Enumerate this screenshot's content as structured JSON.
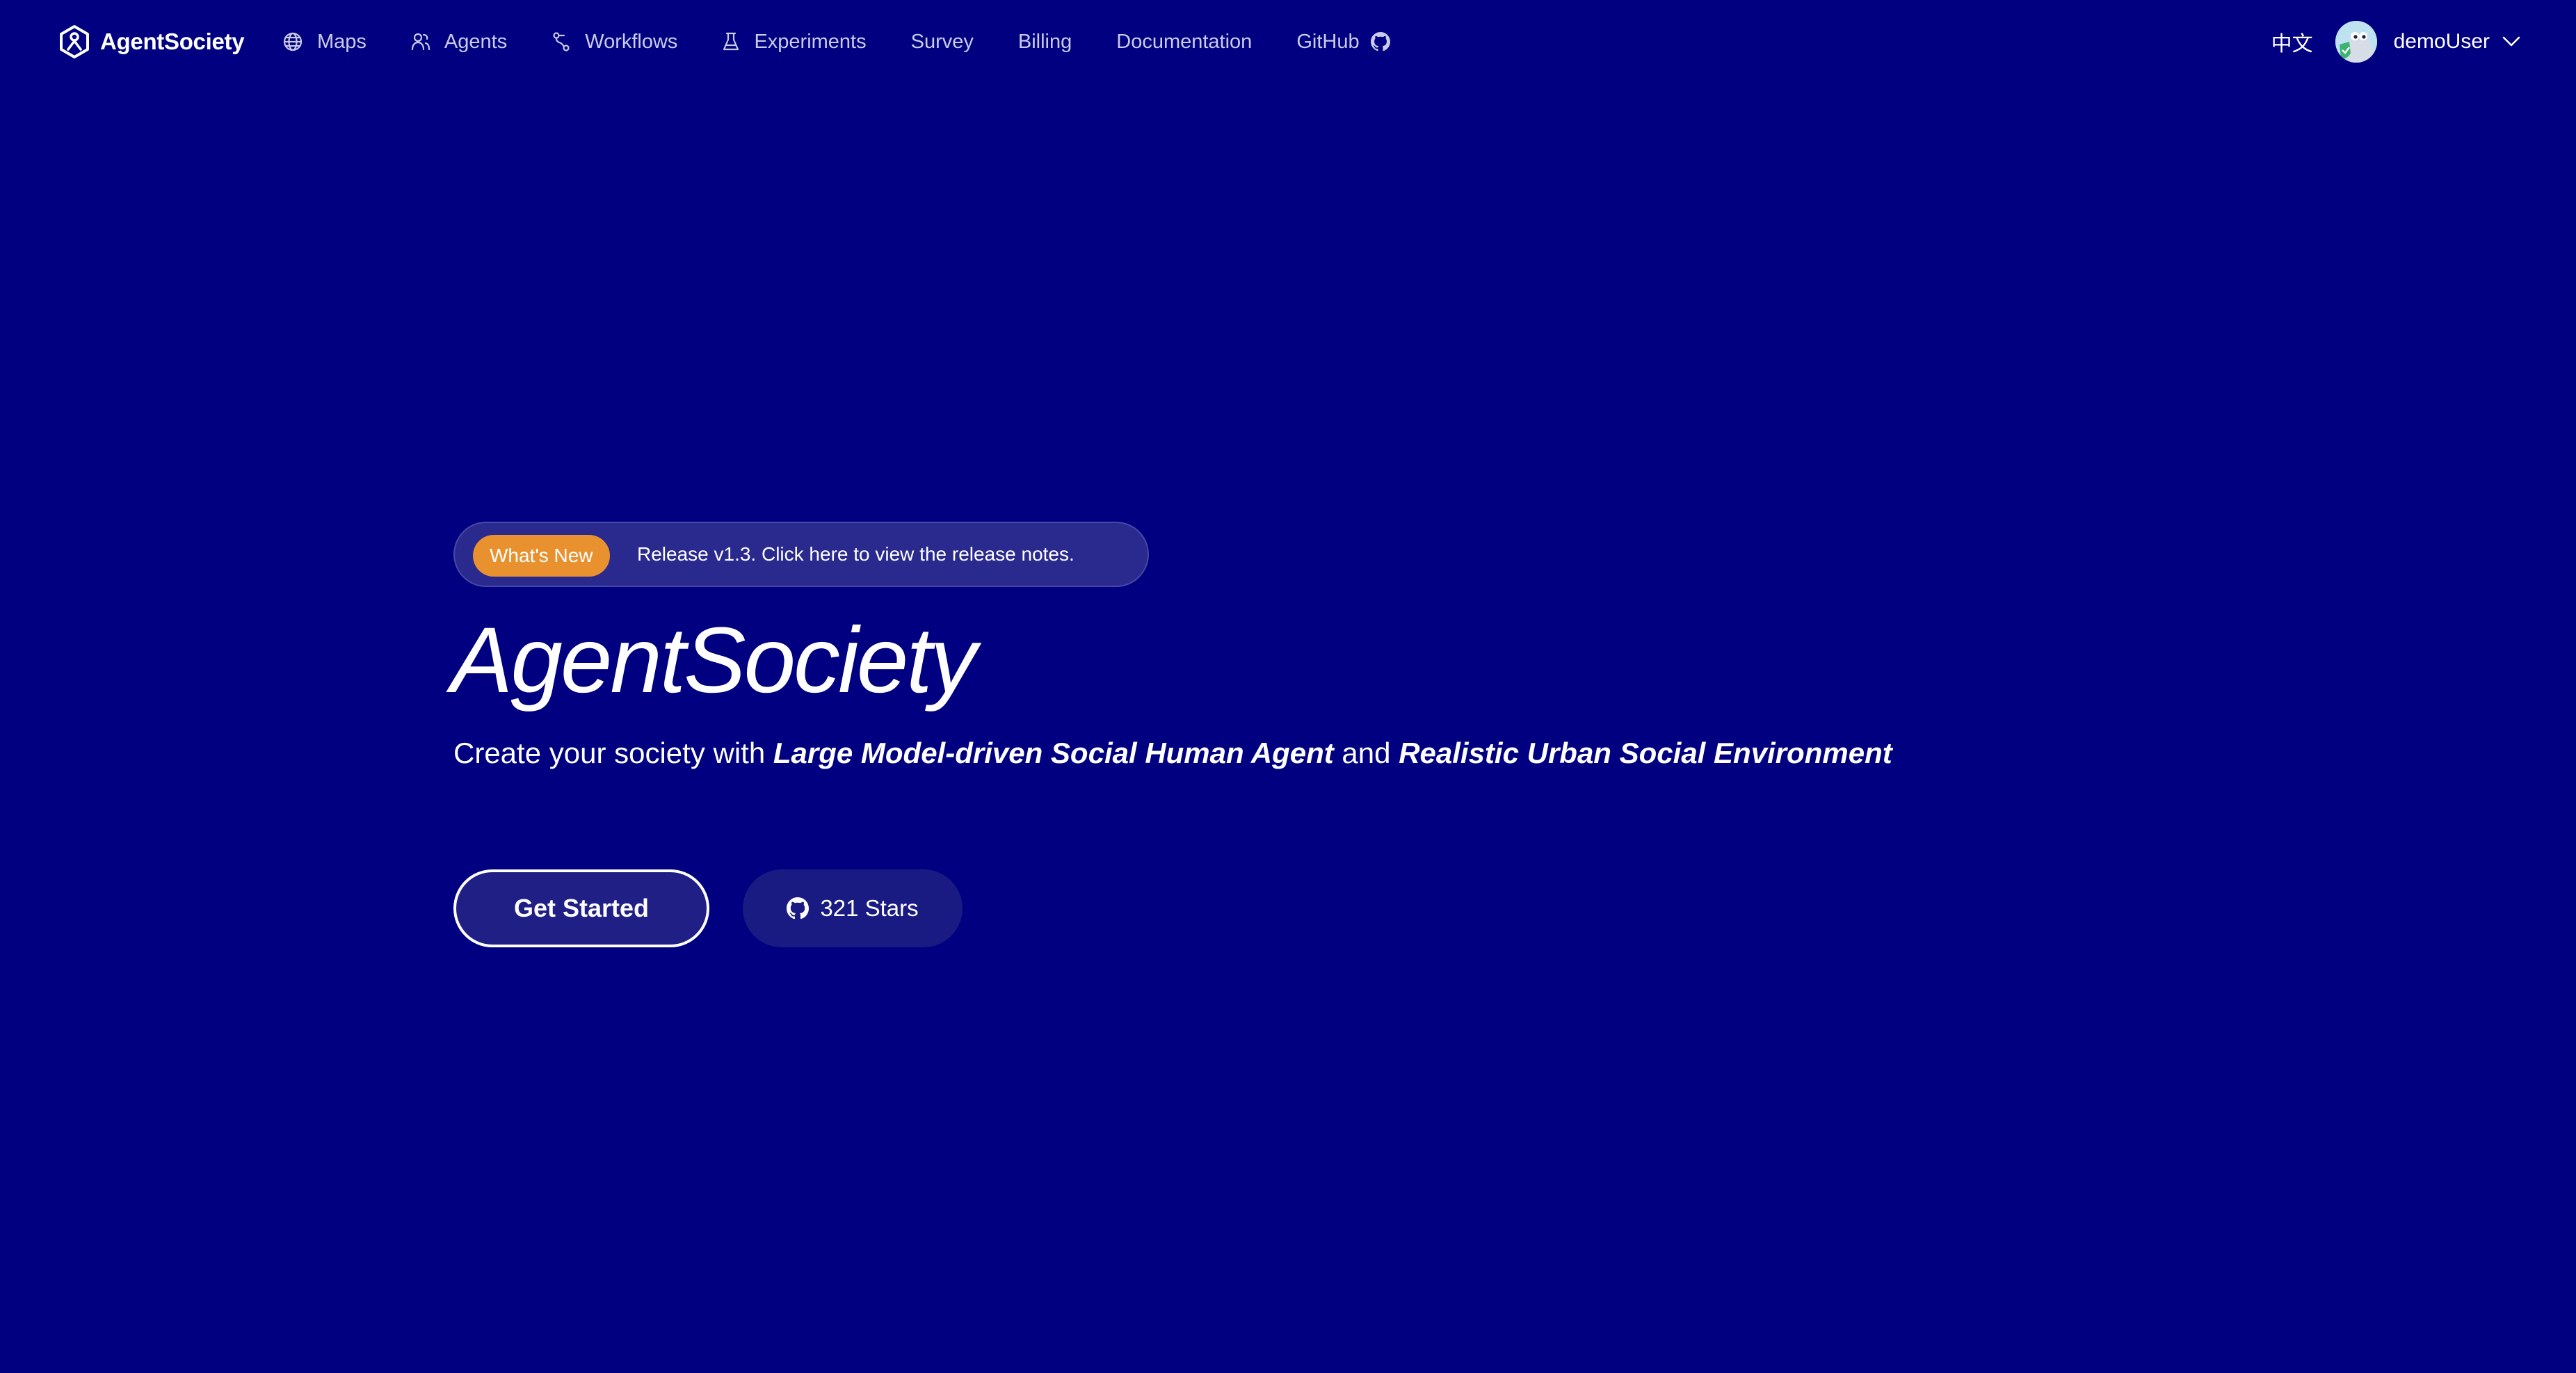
{
  "navbar": {
    "brand": "AgentSociety",
    "items": [
      {
        "label": "Maps",
        "icon": "globe-icon"
      },
      {
        "label": "Agents",
        "icon": "agents-icon"
      },
      {
        "label": "Workflows",
        "icon": "workflow-icon"
      },
      {
        "label": "Experiments",
        "icon": "flask-icon"
      },
      {
        "label": "Survey"
      },
      {
        "label": "Billing"
      },
      {
        "label": "Documentation"
      },
      {
        "label": "GitHub",
        "icon": "github-icon"
      }
    ],
    "language": "中文",
    "user": {
      "name": "demoUser",
      "avatar_icon": "avatar",
      "dropdown_icon": "chevron-down-icon"
    }
  },
  "hero": {
    "badge": "What's New",
    "release_text": "Release v1.3. Click here to view the release notes.",
    "title": "AgentSociety",
    "subtitle": {
      "prefix": "Create your society with ",
      "emph1": "Large Model-driven Social Human Agent",
      "middle": " and ",
      "emph2": "Realistic Urban Social Environment"
    },
    "cta_primary": "Get Started",
    "cta_stars": "321 Stars"
  },
  "colors": {
    "background": "#000080",
    "badge": "#e8912e",
    "nav_text": "#c9cbe8"
  }
}
